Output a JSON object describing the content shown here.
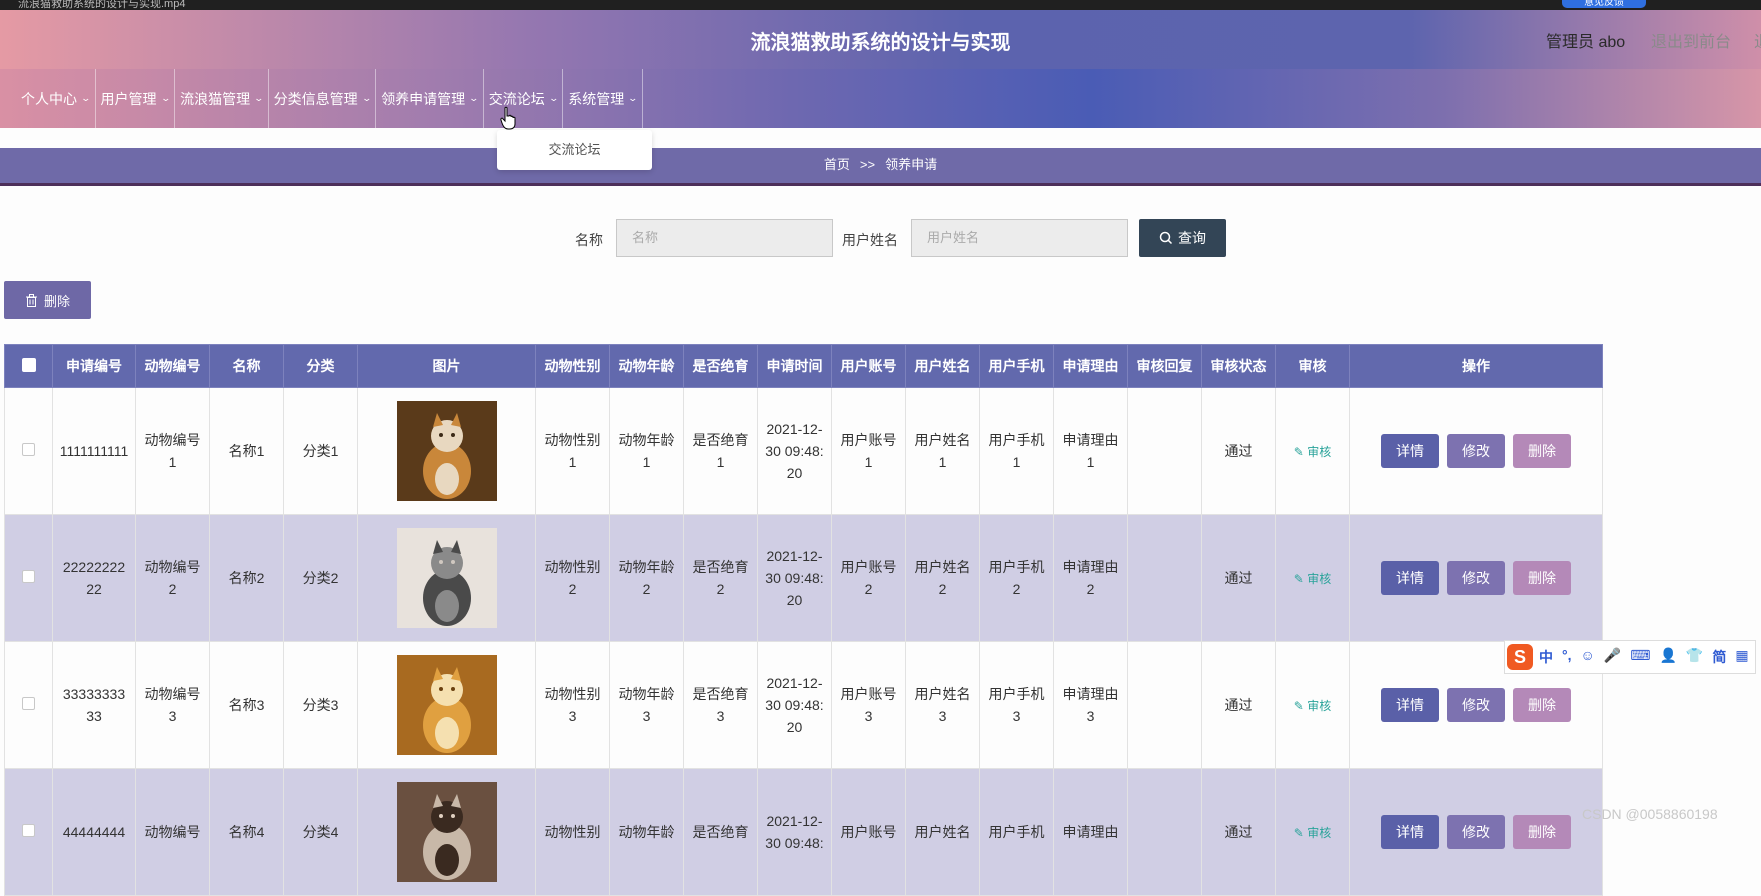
{
  "window": {
    "title": "流浪猫救助系统的设计与实现.mp4",
    "feedback_btn": "意见反馈"
  },
  "header": {
    "title": "流浪猫救助系统的设计与实现",
    "admin": "管理员 abo",
    "exit": "退出到前台",
    "exit_cut": "退"
  },
  "nav": {
    "items": [
      {
        "label": "个人中心"
      },
      {
        "label": "用户管理"
      },
      {
        "label": "流浪猫管理"
      },
      {
        "label": "分类信息管理"
      },
      {
        "label": "领养申请管理"
      },
      {
        "label": "交流论坛"
      },
      {
        "label": "系统管理"
      }
    ],
    "chevron": "chevron-down-icon"
  },
  "dropdown": {
    "item": "交流论坛"
  },
  "breadcrumb": {
    "home": "首页",
    "sep": ">>",
    "current": "领养申请"
  },
  "search": {
    "name_label": "名称",
    "name_placeholder": "名称",
    "user_label": "用户姓名",
    "user_placeholder": "用户姓名",
    "query_label": "查询"
  },
  "actions": {
    "delete_label": "删除"
  },
  "table": {
    "headers": [
      "申请编号",
      "动物编号",
      "名称",
      "分类",
      "图片",
      "动物性别",
      "动物年龄",
      "是否绝育",
      "申请时间",
      "用户账号",
      "用户姓名",
      "用户手机",
      "申请理由",
      "审核回复",
      "审核状态",
      "审核",
      "操作"
    ],
    "rows": [
      {
        "id": "1111111111",
        "animal": "动物编号1",
        "name": "名称1",
        "cat": "分类1",
        "gender": "动物性别1",
        "age": "动物年龄1",
        "neuter": "是否绝育1",
        "time": "2021-12-30 09:48:20",
        "account": "用户账号1",
        "uname": "用户姓名1",
        "phone": "用户手机1",
        "reason": "申请理由1",
        "reply": "",
        "status": "通过",
        "audit": "审核"
      },
      {
        "id": "2222222222",
        "animal": "动物编号2",
        "name": "名称2",
        "cat": "分类2",
        "gender": "动物性别2",
        "age": "动物年龄2",
        "neuter": "是否绝育2",
        "time": "2021-12-30 09:48:20",
        "account": "用户账号2",
        "uname": "用户姓名2",
        "phone": "用户手机2",
        "reason": "申请理由2",
        "reply": "",
        "status": "通过",
        "audit": "审核"
      },
      {
        "id": "3333333333",
        "animal": "动物编号3",
        "name": "名称3",
        "cat": "分类3",
        "gender": "动物性别3",
        "age": "动物年龄3",
        "neuter": "是否绝育3",
        "time": "2021-12-30 09:48:20",
        "account": "用户账号3",
        "uname": "用户姓名3",
        "phone": "用户手机3",
        "reason": "申请理由3",
        "reply": "",
        "status": "通过",
        "audit": "审核"
      },
      {
        "id": "44444444",
        "animal": "动物编号",
        "name": "名称4",
        "cat": "分类4",
        "gender": "动物性别",
        "age": "动物年龄",
        "neuter": "是否绝育",
        "time": "2021-12-30 09:48:",
        "account": "用户账号",
        "uname": "用户姓名",
        "phone": "用户手机",
        "reason": "申请理由",
        "reply": "",
        "status": "通过",
        "audit": "审核"
      }
    ],
    "btn_detail": "详情",
    "btn_edit": "修改",
    "btn_delete": "删除"
  },
  "ime": {
    "logo": "S",
    "items": [
      "中",
      "°,",
      "☺",
      "🎤",
      "⌨",
      "👤",
      "👕",
      "简",
      "▦"
    ]
  },
  "watermark": "CSDN @0058860198",
  "colors": {
    "header_accent": "#5c63ae",
    "table_header": "#6269ad",
    "row_alt": "#d0cee4",
    "query_btn": "#334556"
  }
}
